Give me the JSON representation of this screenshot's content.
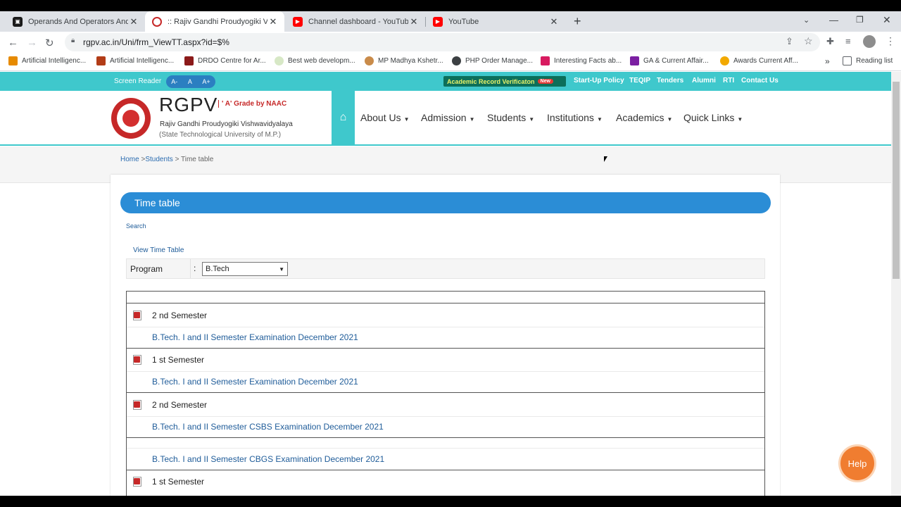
{
  "browser": {
    "tabs": [
      {
        "title": "Operands And Operators And Ex",
        "active": false,
        "icon": "docs-icon"
      },
      {
        "title": ":: Rajiv Gandhi Proudyogiki Vishw",
        "active": true,
        "icon": "rgpv-favicon"
      },
      {
        "title": "Channel dashboard - YouTube St",
        "active": false,
        "icon": "youtube-icon"
      },
      {
        "title": "YouTube",
        "active": false,
        "icon": "youtube-icon"
      }
    ],
    "new_tab": "+",
    "close_glyph": "✕",
    "url": "rgpv.ac.in/Uni/frm_ViewTT.aspx?id=$%",
    "bookmarks": [
      "Artificial Intelligenc...",
      "Artificial Intelligenc...",
      "DRDO Centre for Ar...",
      "Best web developm...",
      "MP Madhya Kshetr...",
      "PHP Order Manage...",
      "Interesting Facts ab...",
      "GA & Current Affair...",
      "Awards Current Aff..."
    ],
    "more": "»",
    "reading_list": "Reading list"
  },
  "site": {
    "screen_reader": "Screen Reader",
    "font_controls": [
      "A-",
      "A",
      "A+"
    ],
    "arv": "Academic Record Verificaton",
    "arv_badge": "New",
    "top_links": [
      "Start-Up Policy",
      "TEQIP",
      "Tenders",
      "Alumni",
      "RTI",
      "Contact Us"
    ],
    "brand": "RGPV",
    "naac": "' A' Grade by NAAC",
    "university_name": "Rajiv Gandhi Proudyogiki Vishwavidyalaya",
    "university_sub": "(State Technological University of M.P.)",
    "nav": [
      "About Us",
      "Admission",
      "Students",
      "Institutions",
      "Academics",
      "Quick Links"
    ],
    "breadcrumb": {
      "home": "Home",
      "sep1": " >",
      "students": "Students",
      "tail": " > Time table"
    },
    "page_title": "Time table",
    "search": "Search",
    "view_tt": "View Time Table",
    "program_label": "Program",
    "colon": ":",
    "program_value": "B.Tech",
    "rows": [
      {
        "semester": "2 nd Semester",
        "link": "B.Tech. I and II Semester Examination December 2021"
      },
      {
        "semester": "1 st Semester",
        "link": "B.Tech. I and II Semester Examination December 2021"
      },
      {
        "semester": "2 nd Semester",
        "link": "B.Tech. I and II Semester CSBS Examination December 2021"
      },
      {
        "semester": "",
        "link": "B.Tech. I and II Semester CBGS Examination December 2021"
      },
      {
        "semester": "1 st Semester",
        "link": ""
      }
    ],
    "help": "Help"
  },
  "colors": {
    "accent": "#3fc8cc",
    "title_bar": "#2b8dd6",
    "help": "#f07d30",
    "link": "#1f5c99"
  }
}
